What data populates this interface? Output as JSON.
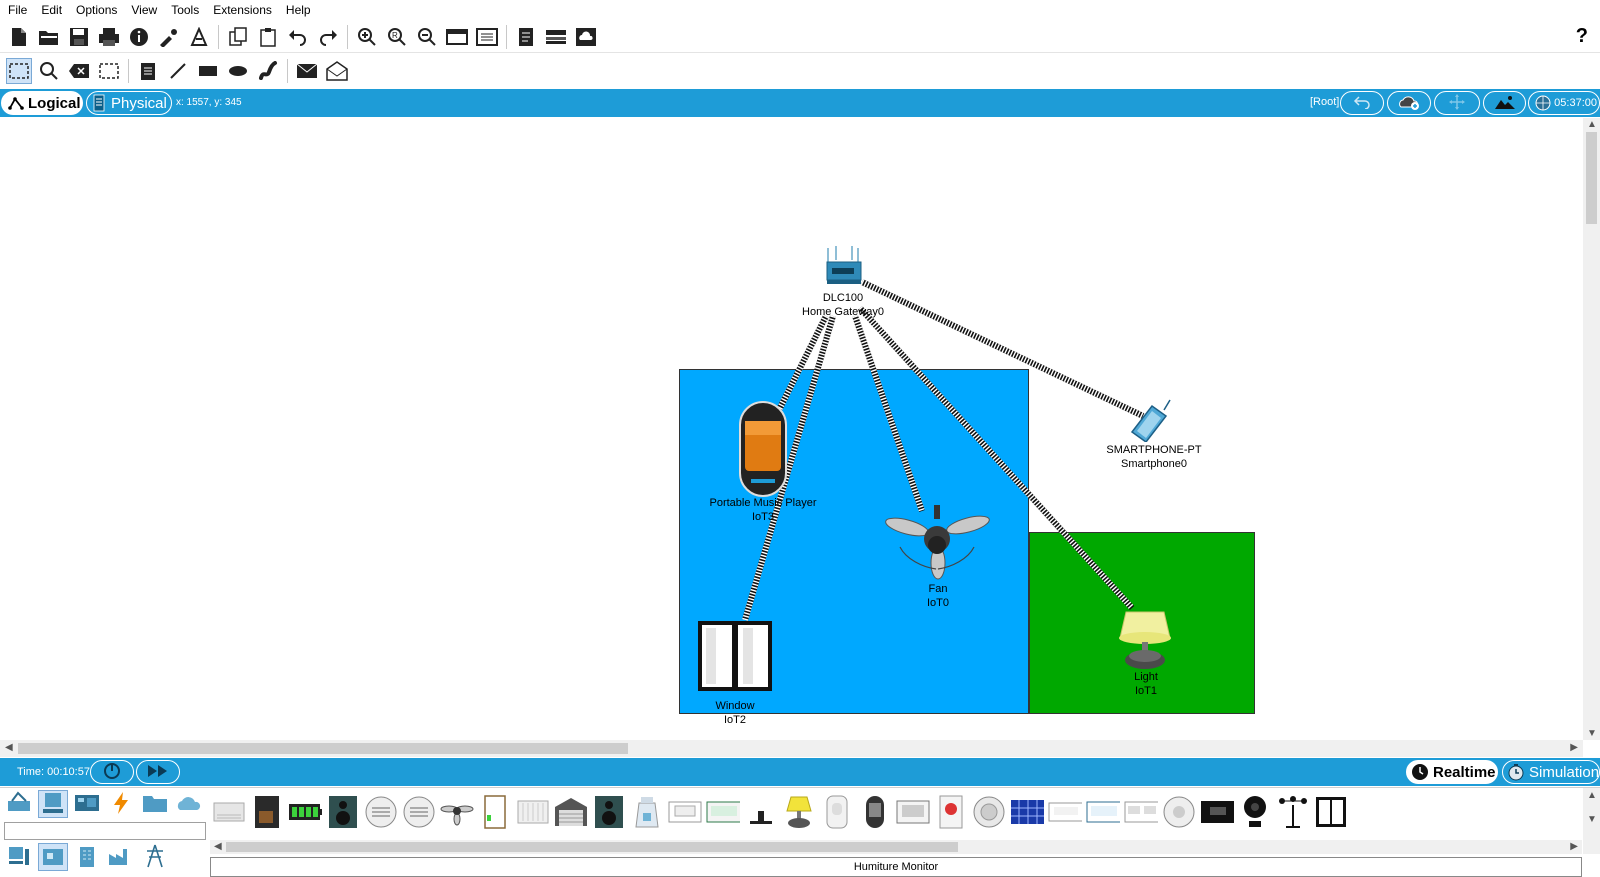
{
  "menu": [
    "File",
    "Edit",
    "Options",
    "View",
    "Tools",
    "Extensions",
    "Help"
  ],
  "toolbar1_icons": [
    "new-file-icon",
    "open-folder-icon",
    "save-icon",
    "print-icon",
    "info-icon",
    "activity-wizard-icon",
    "custom-device-icon",
    "copy-icon",
    "paste-icon",
    "undo-icon",
    "redo-icon",
    "zoom-in-icon",
    "zoom-reset-icon",
    "zoom-out-icon",
    "drawing-palette-icon",
    "custom-devices-dialog-icon",
    "viewport-icon",
    "network-info-icon",
    "cloud-icon"
  ],
  "toolbar2_icons": [
    "select-icon",
    "inspect-icon",
    "delete-icon",
    "resize-icon",
    "note-icon",
    "line-icon",
    "rectangle-icon",
    "ellipse-icon",
    "freeform-icon",
    "simple-pdu-icon",
    "complex-pdu-icon"
  ],
  "help_label": "?",
  "modebar": {
    "logical_label": "Logical",
    "physical_label": "Physical",
    "coords": "x: 1557, y: 345",
    "root_label": "[Root]",
    "clock": "05:37:00"
  },
  "devices": {
    "gateway": {
      "model": "DLC100",
      "name": "Home Gateway0"
    },
    "phone": {
      "model": "SMARTPHONE-PT",
      "name": "Smartphone0"
    },
    "music": {
      "model": "Portable Music Player",
      "name": "IoT3"
    },
    "fan": {
      "model": "Fan",
      "name": "IoT0"
    },
    "window": {
      "model": "Window",
      "name": "IoT2"
    },
    "light": {
      "model": "Light",
      "name": "IoT1"
    }
  },
  "timebar": {
    "time": "Time: 00:10:57",
    "realtime_label": "Realtime",
    "simulation_label": "Simulation"
  },
  "palette": {
    "status": "Humiture Monitor"
  },
  "colors": {
    "accent": "#1e9cd7",
    "room_blue": "#00a8ff",
    "room_green": "#00a800"
  }
}
